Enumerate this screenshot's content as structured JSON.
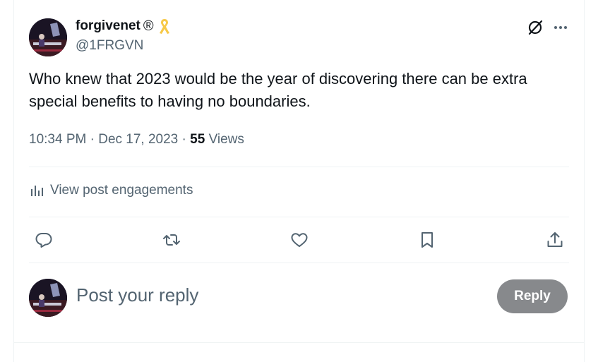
{
  "author": {
    "display_name": "forgivenet",
    "badge_text": "®",
    "handle": "@1FRGVN",
    "ribbon_color": "#f7c948"
  },
  "post": {
    "text": "Who knew that 2023 would be the year of discovering there can be extra special benefits to having no boundaries.",
    "time": "10:34 PM",
    "separator": "·",
    "date": "Dec 17, 2023",
    "views_count": "55",
    "views_label": "Views"
  },
  "engagements_label": "View post engagements",
  "actions": {
    "reply_icon": "speech-bubble-icon",
    "retweet_icon": "retweet-icon",
    "like_icon": "heart-icon",
    "bookmark_icon": "bookmark-icon",
    "share_icon": "share-upload-icon"
  },
  "reply_box": {
    "placeholder": "Post your reply",
    "button_label": "Reply",
    "button_color": "#87898c"
  },
  "colors": {
    "primary_text": "#0f1419",
    "secondary_text": "#536471",
    "divider": "#eff3f4"
  }
}
